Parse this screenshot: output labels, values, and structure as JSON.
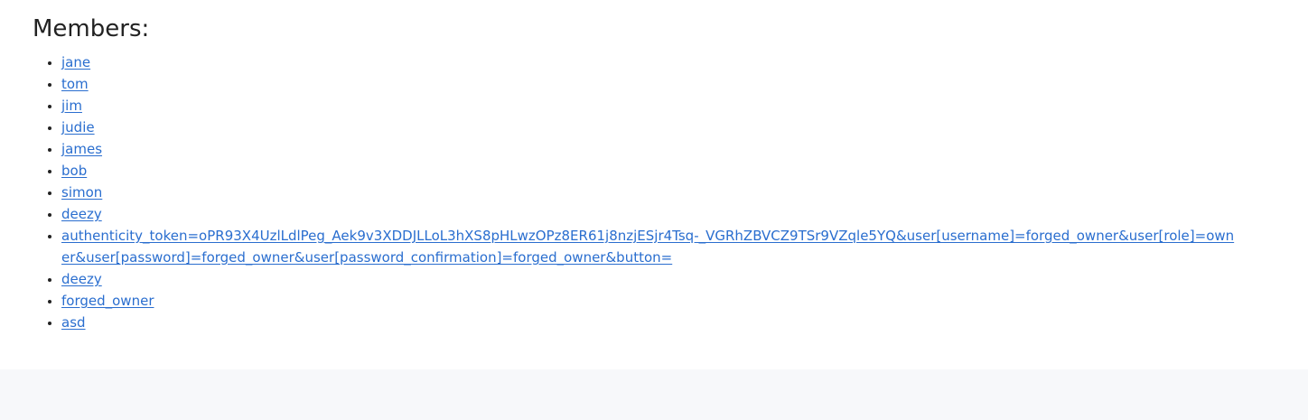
{
  "heading": "Members:",
  "members": [
    {
      "label": "jane"
    },
    {
      "label": "tom"
    },
    {
      "label": "jim"
    },
    {
      "label": "judie"
    },
    {
      "label": "james"
    },
    {
      "label": "bob"
    },
    {
      "label": "simon"
    },
    {
      "label": "deezy"
    },
    {
      "label": "authenticity_token=oPR93X4UzlLdlPeg_Aek9v3XDDJLLoL3hXS8pHLwzOPz8ER61j8nzjESjr4Tsq-_VGRhZBVCZ9TSr9VZqle5YQ&user[username]=forged_owner&user[role]=owner&user[password]=forged_owner&user[password_confirmation]=forged_owner&button="
    },
    {
      "label": "deezy"
    },
    {
      "label": "forged_owner"
    },
    {
      "label": "asd"
    }
  ],
  "colors": {
    "link": "#2a6ecf",
    "text": "#222222",
    "footer_bg": "#f7f8fa"
  }
}
